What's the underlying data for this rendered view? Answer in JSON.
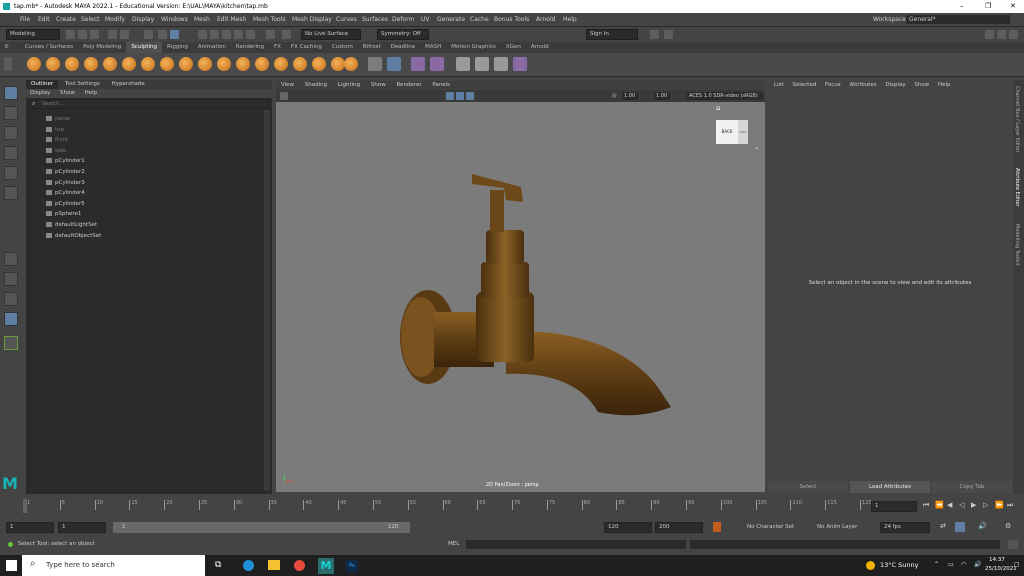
{
  "window": {
    "title": "tap.mb* - Autodesk MAYA 2022.1 - Educational Version: E:\\UAL\\MAYA\\kitchen\\tap.mb",
    "minimize": "–",
    "maximize": "❐",
    "close": "✕"
  },
  "menu": [
    "File",
    "Edit",
    "Create",
    "Select",
    "Modify",
    "Display",
    "Windows",
    "Mesh",
    "Edit Mesh",
    "Mesh Tools",
    "Mesh Display",
    "Curves",
    "Surfaces",
    "Deform",
    "UV",
    "Generate",
    "Cache",
    "Bonus Tools",
    "Arnold",
    "Help"
  ],
  "workspace": {
    "label": "Workspace:",
    "value": "General*"
  },
  "status": {
    "mode": "Modeling",
    "live_surface": "No Live Surface",
    "symmetry": "Symmetry: Off",
    "sign_in": "Sign In"
  },
  "shelf_tabs": [
    "Curves / Surfaces",
    "Poly Modeling",
    "Sculpting",
    "Rigging",
    "Animation",
    "Rendering",
    "FX",
    "FX Caching",
    "Custom",
    "Bifrost",
    "Deadline",
    "MASH",
    "Motion Graphics",
    "XGen",
    "Arnold"
  ],
  "shelf_active": "Sculpting",
  "outliner": {
    "tabs": [
      "Outliner",
      "Tool Settings",
      "Hypershade"
    ],
    "menu": [
      "Display",
      "Show",
      "Help"
    ],
    "search_placeholder": "Search...",
    "items": [
      {
        "label": "persp",
        "dim": true
      },
      {
        "label": "top",
        "dim": true
      },
      {
        "label": "front",
        "dim": true
      },
      {
        "label": "side",
        "dim": true
      },
      {
        "label": "pCylinder1",
        "dim": false
      },
      {
        "label": "pCylinder2",
        "dim": false
      },
      {
        "label": "pCylinder3",
        "dim": false
      },
      {
        "label": "pCylinder4",
        "dim": false
      },
      {
        "label": "pCylinder5",
        "dim": false
      },
      {
        "label": "pSphere1",
        "dim": false
      },
      {
        "label": "defaultLightSet",
        "dim": false
      },
      {
        "label": "defaultObjectSet",
        "dim": false
      }
    ]
  },
  "viewport": {
    "menu": [
      "View",
      "Shading",
      "Lighting",
      "Show",
      "Renderer",
      "Panels"
    ],
    "exposure": "1.00",
    "gamma": "1.00",
    "color_space": "ACES 1.0 SDR-video (sRGB)",
    "cube_label": "BACK",
    "cube_side": "LEFT",
    "hud": "2D Pan/Zoom : persp"
  },
  "attr": {
    "menu": [
      "List",
      "Selected",
      "Focus",
      "Attributes",
      "Display",
      "Show",
      "Help"
    ],
    "message": "Select an object in the scene to view and edit its attributes",
    "buttons": [
      "Select",
      "Load Attributes",
      "Copy Tab"
    ]
  },
  "side_tabs": [
    "Channel Box / Layer Editor",
    "Attribute Editor",
    "Modelling Toolkit"
  ],
  "timeline": {
    "ticks": [
      "1",
      "5",
      "10",
      "15",
      "20",
      "25",
      "30",
      "35",
      "40",
      "45",
      "50",
      "55",
      "60",
      "65",
      "70",
      "75",
      "80",
      "85",
      "90",
      "95",
      "100",
      "105",
      "110",
      "115",
      "120"
    ],
    "current": "1"
  },
  "range": {
    "start": "1",
    "start2": "1",
    "slider_start": "1",
    "slider_end": "120",
    "end": "120",
    "end2": "200",
    "character": "No Character Set",
    "anim_layer": "No Anim Layer",
    "fps": "24 fps"
  },
  "help": {
    "text": "Select Tool: select an object",
    "mel": "MEL"
  },
  "taskbar": {
    "search": "Type here to search",
    "weather": "13°C  Sunny",
    "time": "14:37",
    "date": "25/10/2021"
  }
}
